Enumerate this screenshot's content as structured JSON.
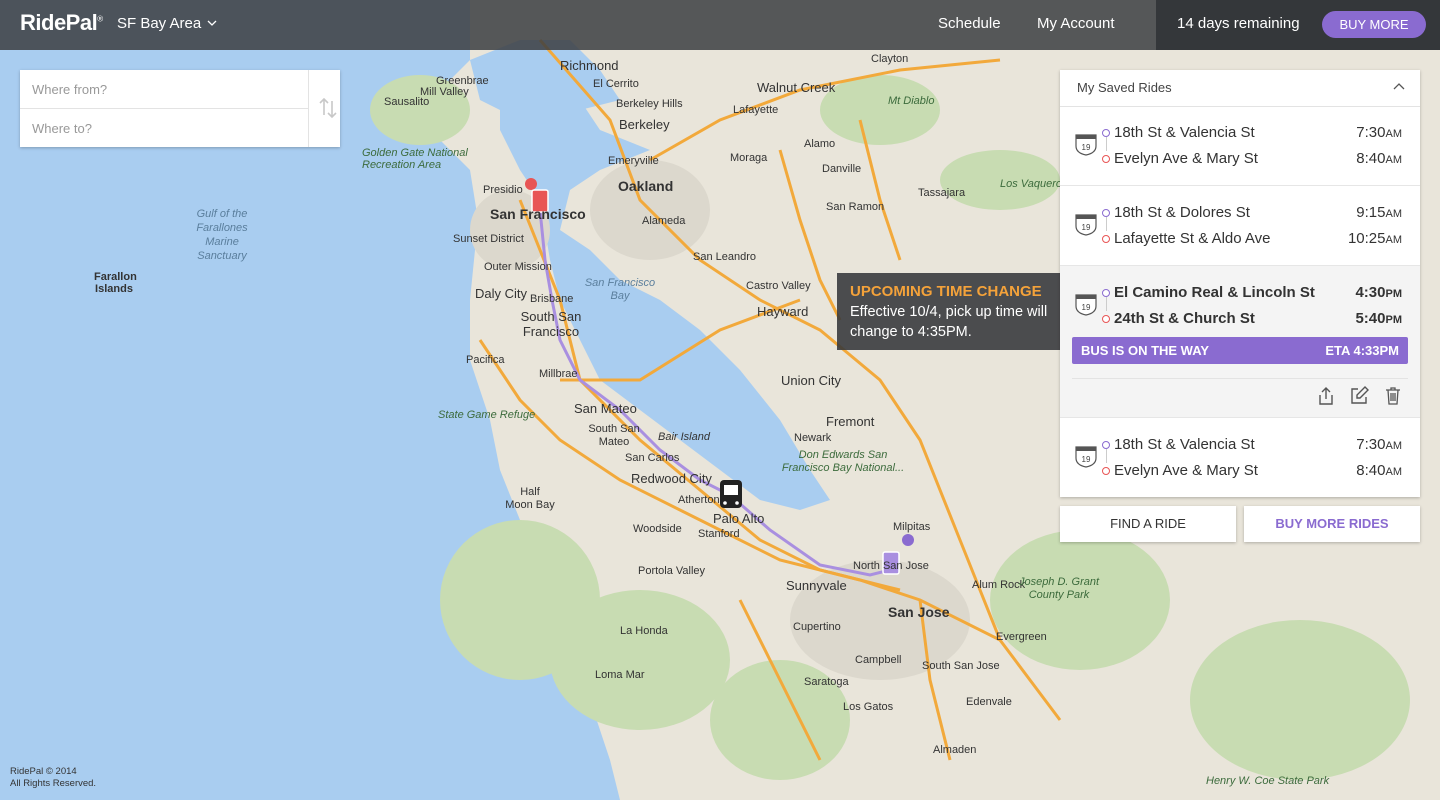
{
  "header": {
    "logo": "RidePal",
    "logo_mark": "®",
    "region": "SF Bay Area",
    "nav": {
      "schedule": "Schedule",
      "account": "My Account"
    },
    "days_remaining": "14 days remaining",
    "buy_more": "BUY MORE"
  },
  "search": {
    "from_placeholder": "Where from?",
    "to_placeholder": "Where to?"
  },
  "tooltip": {
    "title": "UPCOMING TIME CHANGE",
    "body": "Effective 10/4, pick up time will change to 4:35PM."
  },
  "saved_rides": {
    "title": "My Saved Rides",
    "rides": [
      {
        "route": "19",
        "from": "18th St & Valencia St",
        "to": "Evelyn Ave & Mary St",
        "from_time": "7:30",
        "from_ampm": "AM",
        "to_time": "8:40",
        "to_ampm": "AM"
      },
      {
        "route": "19",
        "from": "18th St & Dolores St",
        "to": "Lafayette St & Aldo Ave",
        "from_time": "9:15",
        "from_ampm": "AM",
        "to_time": "10:25",
        "to_ampm": "AM"
      },
      {
        "route": "19",
        "from": "El Camino Real & Lincoln St",
        "to": "24th St & Church St",
        "from_time": "4:30",
        "from_ampm": "PM",
        "to_time": "5:40",
        "to_ampm": "PM",
        "status": "BUS IS ON THE WAY",
        "eta": "ETA 4:33PM"
      },
      {
        "route": "19",
        "from": "18th St & Valencia St",
        "to": "Evelyn Ave & Mary St",
        "from_time": "7:30",
        "from_ampm": "AM",
        "to_time": "8:40",
        "to_ampm": "AM"
      }
    ]
  },
  "buttons": {
    "find_ride": "FIND A RIDE",
    "buy_more_rides": "BUY MORE RIDES"
  },
  "footer": {
    "line1": "RidePal © 2014",
    "line2": "All Rights Reserved."
  },
  "map_labels": {
    "greenbrae": "Greenbrae",
    "richmond": "Richmond",
    "el_cerrito": "El Cerrito",
    "walnut_creek": "Walnut Creek",
    "clayton": "Clayton",
    "mill_valley": "Mill Valley",
    "berkeley_hills": "Berkeley Hills",
    "mt_diablo": "Mt Diablo",
    "berkeley": "Berkeley",
    "lafayette": "Lafayette",
    "sausalito": "Sausalito",
    "alamo": "Alamo",
    "golden_gate": "Golden Gate National Recreation Area",
    "moraga": "Moraga",
    "emeryville": "Emeryville",
    "danville": "Danville",
    "los_vaqueros": "Los Vaqueros Wa",
    "presidio": "Presidio",
    "oakland": "Oakland",
    "tassajara": "Tassajara",
    "san_francisco": "San Francisco",
    "alameda": "Alameda",
    "san_ramon": "San Ramon",
    "gulf_farallones": "Gulf of the Farallones Marine Sanctuary",
    "sunset": "Sunset District",
    "outer_mission": "Outer Mission",
    "san_leandro": "San Leandro",
    "sf_bay": "San Francisco Bay",
    "farallon": "Farallon Islands",
    "daly_city": "Daly City",
    "brisbane": "Brisbane",
    "castro_valley": "Castro Valley",
    "ssf": "South San Francisco",
    "hayward": "Hayward",
    "pacifica": "Pacifica",
    "union_city": "Union City",
    "millbrae": "Millbrae",
    "san_mateo": "San Mateo",
    "state_game": "State Game Refuge",
    "fremont": "Fremont",
    "south_san_mateo": "South San Mateo",
    "bair_island": "Bair Island",
    "newark": "Newark",
    "san_carlos": "San Carlos",
    "don_edwards": "Don Edwards San Francisco Bay National...",
    "redwood_city": "Redwood City",
    "half_moon_bay": "Half Moon Bay",
    "atherton": "Atherton",
    "palo_alto": "Palo Alto",
    "milpitas": "Milpitas",
    "woodside": "Woodside",
    "stanford": "Stanford",
    "north_san_jose": "North San Jose",
    "portola_valley": "Portola Valley",
    "sunnyvale": "Sunnyvale",
    "alum_rock": "Alum Rock",
    "joseph_grant": "Joseph D. Grant County Park",
    "san_jose": "San Jose",
    "la_honda": "La Honda",
    "cupertino": "Cupertino",
    "evergreen": "Evergreen",
    "campbell": "Campbell",
    "south_san_jose": "South San Jose",
    "loma_mar": "Loma Mar",
    "saratoga": "Saratoga",
    "edenvale": "Edenvale",
    "los_gatos": "Los Gatos",
    "almaden": "Almaden",
    "henry_coe": "Henry W. Coe State Park"
  }
}
